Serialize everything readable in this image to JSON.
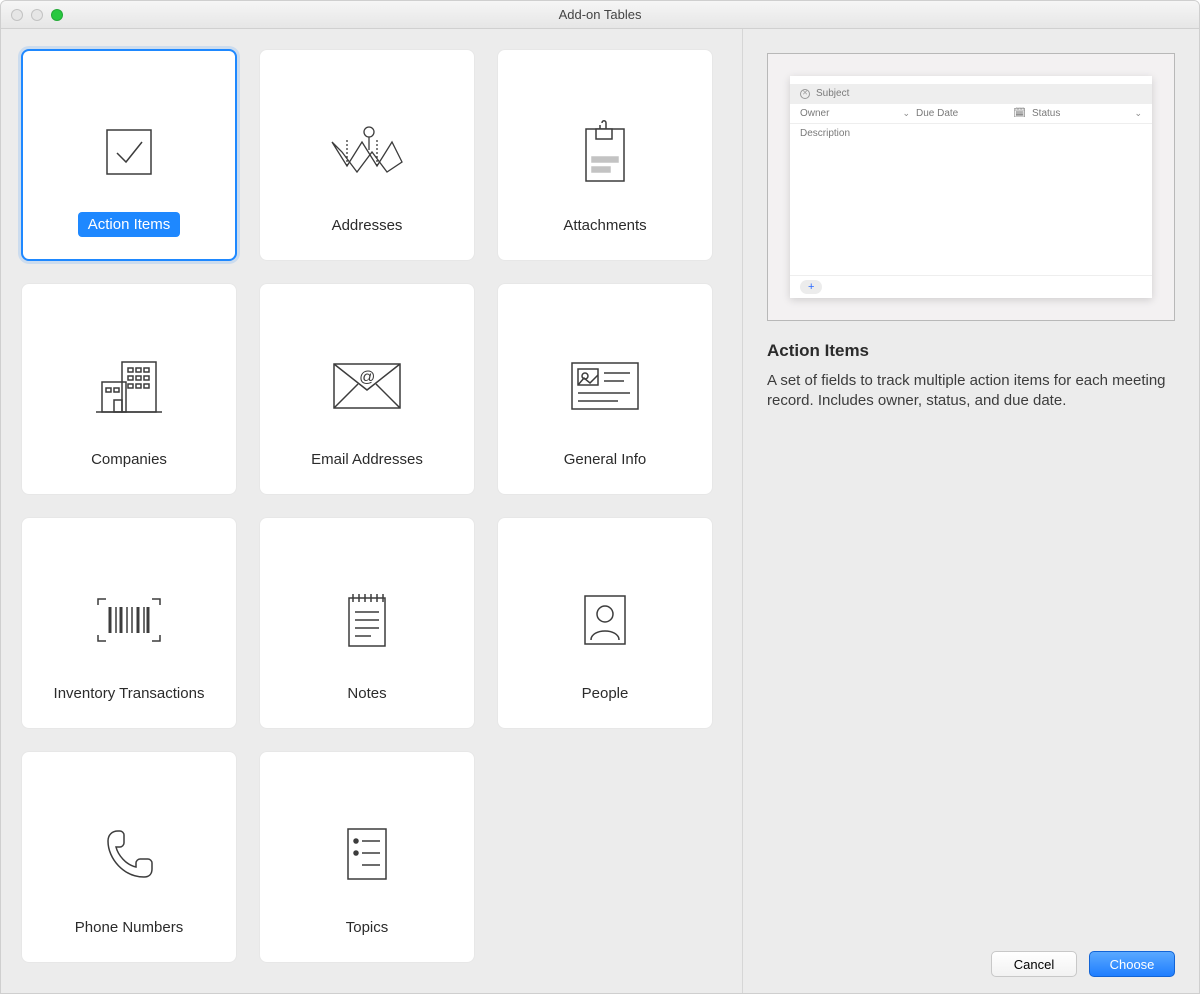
{
  "window": {
    "title": "Add-on Tables"
  },
  "cards": [
    {
      "id": "action-items",
      "label": "Action Items",
      "selected": true
    },
    {
      "id": "addresses",
      "label": "Addresses",
      "selected": false
    },
    {
      "id": "attachments",
      "label": "Attachments",
      "selected": false
    },
    {
      "id": "companies",
      "label": "Companies",
      "selected": false
    },
    {
      "id": "email-addresses",
      "label": "Email Addresses",
      "selected": false
    },
    {
      "id": "general-info",
      "label": "General Info",
      "selected": false
    },
    {
      "id": "inventory-transactions",
      "label": "Inventory Transactions",
      "selected": false
    },
    {
      "id": "notes",
      "label": "Notes",
      "selected": false
    },
    {
      "id": "people",
      "label": "People",
      "selected": false
    },
    {
      "id": "phone-numbers",
      "label": "Phone Numbers",
      "selected": false
    },
    {
      "id": "topics",
      "label": "Topics",
      "selected": false
    }
  ],
  "preview": {
    "subject_label": "Subject",
    "owner_label": "Owner",
    "due_date_label": "Due Date",
    "status_label": "Status",
    "description_label": "Description",
    "add_symbol": "+"
  },
  "detail": {
    "heading": "Action Items",
    "description": "A set of fields to track multiple action items for each meeting record. Includes owner, status, and due date."
  },
  "buttons": {
    "cancel": "Cancel",
    "choose": "Choose"
  }
}
